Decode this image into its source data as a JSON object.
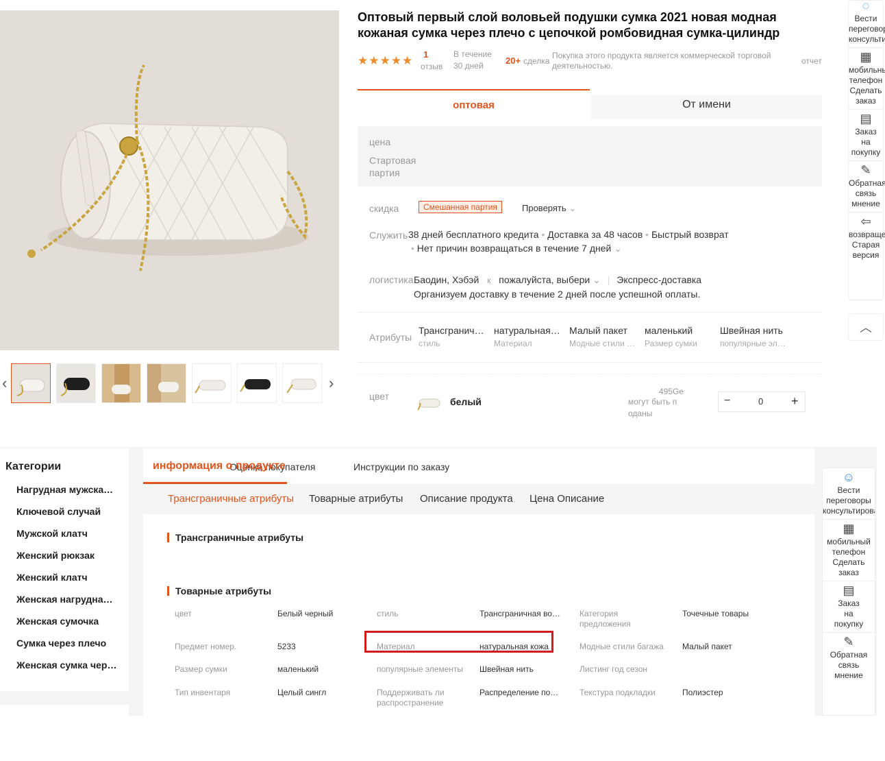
{
  "product": {
    "title": "Оптовый первый слой воловьей подушки сумка 2021 новая модная кожаная сумка через плечо с цепочкой ромбовидная сумка-цилиндр",
    "stars": "★★★★★",
    "review_count": "1",
    "review_label": "отзыв",
    "period_label_1": "В течение",
    "period_label_2": "30 дней",
    "deals_count": "20+",
    "deals_label": "сделка",
    "commercial_note": "Покупка этого продукта является коммерческой торговой деятельностью.",
    "report_link": "отчет"
  },
  "buy_tabs": {
    "wholesale": "оптовая",
    "on_behalf": "От имени"
  },
  "price": {
    "price_label": "цена",
    "moq_label_1": "Стартовая",
    "moq_label_2": "партия"
  },
  "discount": {
    "label": "скидка",
    "tag": "Смешанная партия",
    "check": "Проверять"
  },
  "service": {
    "label": "Служить",
    "items": [
      "38 дней бесплатного кредита",
      "Доставка за 48 часов",
      "Быстрый возврат"
    ],
    "line2": "Нет причин возвращаться в течение 7 дней"
  },
  "logistics": {
    "label": "логистика",
    "from": "Баодин, Хэбэй",
    "to": "к",
    "choose": "пожалуйста, выбери",
    "method": "Экспресс-доставка",
    "note": "Организуем доставку в течение 2 дней после успешной оплаты."
  },
  "attributes": {
    "label": "Атрибуты",
    "items": [
      {
        "value": "Трансграничная",
        "key": "стиль"
      },
      {
        "value": "натуральная кожа",
        "key": "Материал"
      },
      {
        "value": "Малый пакет",
        "key": "Модные стили багажа"
      },
      {
        "value": "маленький",
        "key": "Размер сумки"
      },
      {
        "value": "Швейная нить",
        "key": "популярные элементы"
      }
    ]
  },
  "color": {
    "label": "цвет",
    "name": "белый",
    "stock_1": "495Ge",
    "stock_2": "могут быть п",
    "stock_3": "оданы",
    "qty": "0",
    "minus": "−",
    "plus": "+"
  },
  "gallery": {
    "prev": "‹",
    "next": "›"
  },
  "right_rail": {
    "items": [
      {
        "l1": "Вести",
        "l2": "переговоры",
        "l3": "консультирова"
      },
      {
        "l1": "мобильный",
        "l2": "телефон",
        "l3": "Сделать",
        "l4": "заказ"
      },
      {
        "l1": "Заказ",
        "l2": "на",
        "l3": "покупку"
      },
      {
        "l1": "Обратная",
        "l2": "связь",
        "l3": "мнение"
      },
      {
        "l1": "возвращени",
        "l2": "Старая",
        "l3": "версия"
      }
    ],
    "top_arrow": "︿"
  },
  "categories": {
    "title": "Категории",
    "items": [
      "Нагрудная мужская сумка",
      "Ключевой случай",
      "Мужской клатч",
      "Женский рюкзак",
      "Женский клатч",
      "Женская нагрудная сумка",
      "Женская сумочка",
      "Сумка через плечо",
      "Женская сумка через плечо"
    ]
  },
  "info_tabs": {
    "active": "информация о продукте",
    "overlap": "Оценка покупателя",
    "instructions": "Инструкции по заказу"
  },
  "sub_tabs": [
    "Трансграничные атрибуты",
    "Товарные атрибуты",
    "Описание продукта",
    "Цена Описание"
  ],
  "sections": {
    "cross_border": "Трансграничные атрибуты",
    "product_attrs": "Товарные атрибуты"
  },
  "attr_grid": [
    [
      {
        "k": "цвет",
        "v": "Белый черный"
      },
      {
        "k": "стиль",
        "v": "Трансграничная возможность"
      },
      {
        "k": "Категория предложения",
        "v": "Точечные товары"
      }
    ],
    [
      {
        "k": "Предмет номер.",
        "v": "5233"
      },
      {
        "k": "Материал",
        "v": "натуральная кожа"
      },
      {
        "k": "Модные стили багажа",
        "v": "Малый пакет"
      }
    ],
    [
      {
        "k": "Размер сумки",
        "v": "маленький"
      },
      {
        "k": "популярные элементы",
        "v": "Швейная нить"
      },
      {
        "k": "Листинг год сезон",
        "v": ""
      }
    ],
    [
      {
        "k": "Тип инвентаря",
        "v": "Целый сингл"
      },
      {
        "k": "Поддерживать ли распространение",
        "v": "Распределение поддержки"
      },
      {
        "k": "Текстура подкладки",
        "v": "Полиэстер"
      }
    ]
  ],
  "right_rail_2": {
    "items": [
      {
        "l1": "Вести",
        "l2": "переговоры",
        "l3": "консультирова"
      },
      {
        "l1": "мобильный",
        "l2": "телефон",
        "l3": "Сделать",
        "l4": "заказ"
      },
      {
        "l1": "Заказ",
        "l2": "на",
        "l3": "покупку"
      },
      {
        "l1": "Обратная",
        "l2": "связь",
        "l3": "мнение"
      }
    ]
  },
  "colors": {
    "accent": "#e4531b",
    "highlight": "#d21c1c",
    "star": "#f08a2a"
  }
}
